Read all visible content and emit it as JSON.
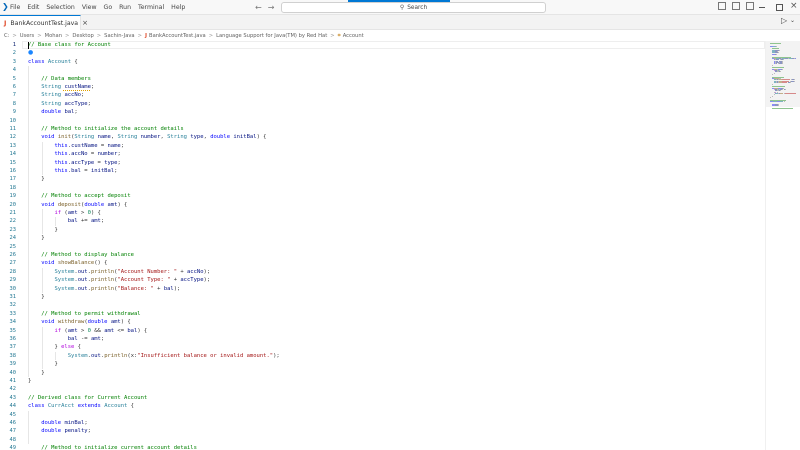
{
  "menu": [
    "File",
    "Edit",
    "Selection",
    "View",
    "Go",
    "Run",
    "Terminal",
    "Help"
  ],
  "search": {
    "text": "Search",
    "icon": "search-icon"
  },
  "tab": {
    "label": "BankAccountTest.java",
    "close": "×",
    "icon": "java-icon"
  },
  "breadcrumb": [
    "C:",
    "Users",
    "Mohan",
    "Desktop",
    "Sachin-Java",
    "BankAccountTest.java",
    "Language Support for Java(TM) by Red Hat",
    "Account"
  ],
  "colors": {
    "accent": "#0078d4",
    "line_number": "#237893",
    "comment": "#008000",
    "keyword": "#0000ff",
    "type": "#267f99",
    "function": "#795e26",
    "variable": "#001080",
    "string": "#a31515",
    "number": "#098658",
    "control": "#af00db"
  },
  "editor": {
    "active_line": 1,
    "lines": [
      {
        "n": "1",
        "t": [
          [
            "c",
            "// Base class for Account"
          ]
        ]
      },
      {
        "n": "2",
        "t": []
      },
      {
        "n": "3",
        "t": [
          [
            "k",
            "class "
          ],
          [
            "y",
            "Account"
          ],
          [
            "p",
            " {"
          ]
        ]
      },
      {
        "n": "4",
        "t": []
      },
      {
        "n": "5",
        "t": [
          [
            "p",
            "    "
          ],
          [
            "c",
            "// Data members"
          ]
        ]
      },
      {
        "n": "6",
        "t": [
          [
            "p",
            "    "
          ],
          [
            "y",
            "String "
          ],
          [
            "v",
            "custName"
          ],
          [
            "p",
            ";"
          ]
        ]
      },
      {
        "n": "7",
        "t": [
          [
            "p",
            "    "
          ],
          [
            "y",
            "String "
          ],
          [
            "v",
            "accNo"
          ],
          [
            "p",
            ";"
          ]
        ]
      },
      {
        "n": "8",
        "t": [
          [
            "p",
            "    "
          ],
          [
            "y",
            "String "
          ],
          [
            "v",
            "accType"
          ],
          [
            "p",
            ";"
          ]
        ]
      },
      {
        "n": "9",
        "t": [
          [
            "p",
            "    "
          ],
          [
            "k",
            "double "
          ],
          [
            "v",
            "bal"
          ],
          [
            "p",
            ";"
          ]
        ]
      },
      {
        "n": "10",
        "t": []
      },
      {
        "n": "11",
        "t": [
          [
            "p",
            "    "
          ],
          [
            "c",
            "// Method to initialize the account details"
          ]
        ]
      },
      {
        "n": "12",
        "t": [
          [
            "p",
            "    "
          ],
          [
            "k",
            "void "
          ],
          [
            "f",
            "init"
          ],
          [
            "p",
            "("
          ],
          [
            "y",
            "String "
          ],
          [
            "v",
            "name"
          ],
          [
            "p",
            ", "
          ],
          [
            "y",
            "String "
          ],
          [
            "v",
            "number"
          ],
          [
            "p",
            ", "
          ],
          [
            "y",
            "String "
          ],
          [
            "v",
            "type"
          ],
          [
            "p",
            ", "
          ],
          [
            "k",
            "double "
          ],
          [
            "v",
            "initBal"
          ],
          [
            "p",
            ") {"
          ]
        ]
      },
      {
        "n": "13",
        "t": [
          [
            "p",
            "        "
          ],
          [
            "k",
            "this"
          ],
          [
            "p",
            "."
          ],
          [
            "v",
            "custName"
          ],
          [
            "p",
            " = "
          ],
          [
            "v",
            "name"
          ],
          [
            "p",
            ";"
          ]
        ]
      },
      {
        "n": "14",
        "t": [
          [
            "p",
            "        "
          ],
          [
            "k",
            "this"
          ],
          [
            "p",
            "."
          ],
          [
            "v",
            "accNo"
          ],
          [
            "p",
            " = "
          ],
          [
            "v",
            "number"
          ],
          [
            "p",
            ";"
          ]
        ]
      },
      {
        "n": "15",
        "t": [
          [
            "p",
            "        "
          ],
          [
            "k",
            "this"
          ],
          [
            "p",
            "."
          ],
          [
            "v",
            "accType"
          ],
          [
            "p",
            " = "
          ],
          [
            "v",
            "type"
          ],
          [
            "p",
            ";"
          ]
        ]
      },
      {
        "n": "16",
        "t": [
          [
            "p",
            "        "
          ],
          [
            "k",
            "this"
          ],
          [
            "p",
            "."
          ],
          [
            "v",
            "bal"
          ],
          [
            "p",
            " = "
          ],
          [
            "v",
            "initBal"
          ],
          [
            "p",
            ";"
          ]
        ]
      },
      {
        "n": "17",
        "t": [
          [
            "p",
            "    }"
          ]
        ]
      },
      {
        "n": "18",
        "t": []
      },
      {
        "n": "19",
        "t": [
          [
            "p",
            "    "
          ],
          [
            "c",
            "// Method to accept deposit"
          ]
        ]
      },
      {
        "n": "20",
        "t": [
          [
            "p",
            "    "
          ],
          [
            "k",
            "void "
          ],
          [
            "f",
            "deposit"
          ],
          [
            "p",
            "("
          ],
          [
            "k",
            "double "
          ],
          [
            "v",
            "amt"
          ],
          [
            "p",
            ") {"
          ]
        ]
      },
      {
        "n": "21",
        "t": [
          [
            "p",
            "        "
          ],
          [
            "x",
            "if"
          ],
          [
            "p",
            " ("
          ],
          [
            "v",
            "amt"
          ],
          [
            "p",
            " > "
          ],
          [
            "n",
            "0"
          ],
          [
            "p",
            ") {"
          ]
        ]
      },
      {
        "n": "22",
        "t": [
          [
            "p",
            "            "
          ],
          [
            "v",
            "bal"
          ],
          [
            "p",
            " += "
          ],
          [
            "v",
            "amt"
          ],
          [
            "p",
            ";"
          ]
        ]
      },
      {
        "n": "23",
        "t": [
          [
            "p",
            "        }"
          ]
        ]
      },
      {
        "n": "24",
        "t": [
          [
            "p",
            "    }"
          ]
        ]
      },
      {
        "n": "25",
        "t": []
      },
      {
        "n": "26",
        "t": [
          [
            "p",
            "    "
          ],
          [
            "c",
            "// Method to display balance"
          ]
        ]
      },
      {
        "n": "27",
        "t": [
          [
            "p",
            "    "
          ],
          [
            "k",
            "void "
          ],
          [
            "f",
            "showBalance"
          ],
          [
            "p",
            "() {"
          ]
        ]
      },
      {
        "n": "28",
        "t": [
          [
            "p",
            "        "
          ],
          [
            "y",
            "System"
          ],
          [
            "p",
            "."
          ],
          [
            "v",
            "out"
          ],
          [
            "p",
            "."
          ],
          [
            "f",
            "println"
          ],
          [
            "p",
            "("
          ],
          [
            "s",
            "\"Account Number: \""
          ],
          [
            "p",
            " + "
          ],
          [
            "v",
            "accNo"
          ],
          [
            "p",
            ");"
          ]
        ]
      },
      {
        "n": "29",
        "t": [
          [
            "p",
            "        "
          ],
          [
            "y",
            "System"
          ],
          [
            "p",
            "."
          ],
          [
            "v",
            "out"
          ],
          [
            "p",
            "."
          ],
          [
            "f",
            "println"
          ],
          [
            "p",
            "("
          ],
          [
            "s",
            "\"Account Type: \""
          ],
          [
            "p",
            " + "
          ],
          [
            "v",
            "accType"
          ],
          [
            "p",
            ");"
          ]
        ]
      },
      {
        "n": "30",
        "t": [
          [
            "p",
            "        "
          ],
          [
            "y",
            "System"
          ],
          [
            "p",
            "."
          ],
          [
            "v",
            "out"
          ],
          [
            "p",
            "."
          ],
          [
            "f",
            "println"
          ],
          [
            "p",
            "("
          ],
          [
            "s",
            "\"Balance: \""
          ],
          [
            "p",
            " + "
          ],
          [
            "v",
            "bal"
          ],
          [
            "p",
            ");"
          ]
        ]
      },
      {
        "n": "31",
        "t": [
          [
            "p",
            "    }"
          ]
        ]
      },
      {
        "n": "32",
        "t": []
      },
      {
        "n": "33",
        "t": [
          [
            "p",
            "    "
          ],
          [
            "c",
            "// Method to permit withdrawal"
          ]
        ]
      },
      {
        "n": "34",
        "t": [
          [
            "p",
            "    "
          ],
          [
            "k",
            "void "
          ],
          [
            "f",
            "withdraw"
          ],
          [
            "p",
            "("
          ],
          [
            "k",
            "double "
          ],
          [
            "v",
            "amt"
          ],
          [
            "p",
            ") {"
          ]
        ]
      },
      {
        "n": "35",
        "t": [
          [
            "p",
            "        "
          ],
          [
            "x",
            "if"
          ],
          [
            "p",
            " ("
          ],
          [
            "v",
            "amt"
          ],
          [
            "p",
            " > "
          ],
          [
            "n",
            "0"
          ],
          [
            "p",
            " && "
          ],
          [
            "v",
            "amt"
          ],
          [
            "p",
            " <= "
          ],
          [
            "v",
            "bal"
          ],
          [
            "p",
            ") {"
          ]
        ]
      },
      {
        "n": "36",
        "t": [
          [
            "p",
            "            "
          ],
          [
            "v",
            "bal"
          ],
          [
            "p",
            " -= "
          ],
          [
            "v",
            "amt"
          ],
          [
            "p",
            ";"
          ]
        ]
      },
      {
        "n": "37",
        "t": [
          [
            "p",
            "        } "
          ],
          [
            "x",
            "else"
          ],
          [
            "p",
            " {"
          ]
        ]
      },
      {
        "n": "38",
        "t": [
          [
            "p",
            "            "
          ],
          [
            "y",
            "System"
          ],
          [
            "p",
            "."
          ],
          [
            "v",
            "out"
          ],
          [
            "p",
            "."
          ],
          [
            "f",
            "println"
          ],
          [
            "p",
            "("
          ],
          [
            "p",
            "x:"
          ],
          [
            "s",
            "\"Insufficient balance or invalid amount.\""
          ],
          [
            "p",
            ");"
          ]
        ]
      },
      {
        "n": "39",
        "t": [
          [
            "p",
            "        }"
          ]
        ]
      },
      {
        "n": "40",
        "t": [
          [
            "p",
            "    }"
          ]
        ]
      },
      {
        "n": "41",
        "t": [
          [
            "p",
            "}"
          ]
        ]
      },
      {
        "n": "42",
        "t": []
      },
      {
        "n": "43",
        "t": [
          [
            "c",
            "// Derived class for Current Account"
          ]
        ]
      },
      {
        "n": "44",
        "t": [
          [
            "k",
            "class "
          ],
          [
            "y",
            "CurrAcct "
          ],
          [
            "k",
            "extends "
          ],
          [
            "y",
            "Account"
          ],
          [
            "p",
            " {"
          ]
        ]
      },
      {
        "n": "45",
        "t": []
      },
      {
        "n": "46",
        "t": [
          [
            "p",
            "    "
          ],
          [
            "k",
            "double "
          ],
          [
            "v",
            "minBal"
          ],
          [
            "p",
            ";"
          ]
        ]
      },
      {
        "n": "47",
        "t": [
          [
            "p",
            "    "
          ],
          [
            "k",
            "double "
          ],
          [
            "v",
            "penalty"
          ],
          [
            "p",
            ";"
          ]
        ]
      },
      {
        "n": "48",
        "t": []
      },
      {
        "n": "49",
        "t": [
          [
            "p",
            "    "
          ],
          [
            "c",
            "// Method to initialize current account details"
          ]
        ]
      }
    ]
  }
}
